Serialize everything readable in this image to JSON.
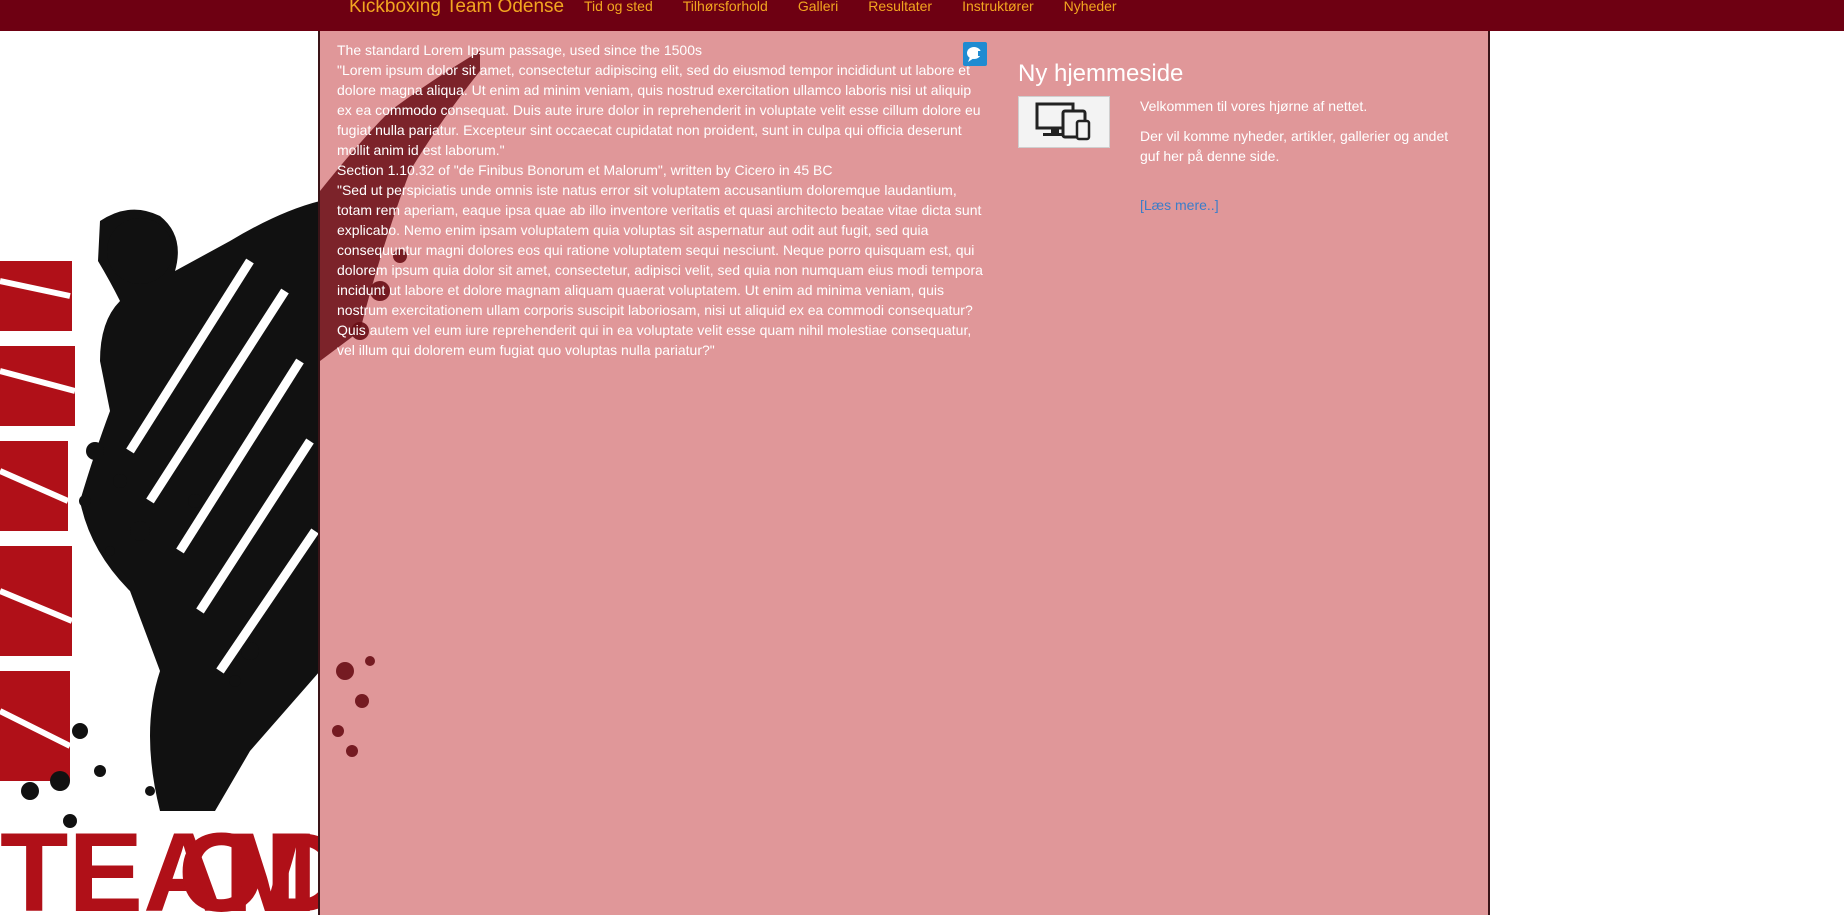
{
  "navbar": {
    "brand": "Kickboxing Team Odense",
    "links": [
      "Tid og sted",
      "Tilhørsforhold",
      "Galleri",
      "Resultater",
      "Instruktører",
      "Nyheder"
    ]
  },
  "background": {
    "logo_word": "ODENSE",
    "logo_partial": "TEAM"
  },
  "main": {
    "paragraphs": [
      "The standard Lorem Ipsum passage, used since the 1500s",
      "\"Lorem ipsum dolor sit amet, consectetur adipiscing elit, sed do eiusmod tempor incididunt ut labore et dolore magna aliqua. Ut enim ad minim veniam, quis nostrud exercitation ullamco laboris nisi ut aliquip ex ea commodo consequat. Duis aute irure dolor in reprehenderit in voluptate velit esse cillum dolore eu fugiat nulla pariatur. Excepteur sint occaecat cupidatat non proident, sunt in culpa qui officia deserunt mollit anim id est laborum.\"",
      "Section 1.10.32 of \"de Finibus Bonorum et Malorum\", written by Cicero in 45 BC",
      "\"Sed ut perspiciatis unde omnis iste natus error sit voluptatem accusantium doloremque laudantium, totam rem aperiam, eaque ipsa quae ab illo inventore veritatis et quasi architecto beatae vitae dicta sunt explicabo. Nemo enim ipsam voluptatem quia voluptas sit aspernatur aut odit aut fugit, sed quia consequuntur magni dolores eos qui ratione voluptatem sequi nesciunt. Neque porro quisquam est, qui dolorem ipsum quia dolor sit amet, consectetur, adipisci velit, sed quia non numquam eius modi tempora incidunt ut labore et dolore magnam aliquam quaerat voluptatem. Ut enim ad minima veniam, quis nostrum exercitationem ullam corporis suscipit laboriosam, nisi ut aliquid ex ea commodi consequatur? Quis autem vel eum iure reprehenderit qui in ea voluptate velit esse quam nihil molestiae consequatur, vel illum qui dolorem eum fugiat quo voluptas nulla pariatur?\""
    ],
    "chat_icon": "chat-bubble-icon"
  },
  "sidebar": {
    "title": "Ny hjemmeside",
    "thumbnail_icon": "devices-icon",
    "text": [
      "Velkommen til vores hjørne af nettet.",
      "Der vil komme nyheder, artikler, gallerier og andet guf her på denne side."
    ],
    "read_more": "[Læs mere..]"
  },
  "colors": {
    "navbar_bg": "#6e0012",
    "nav_link": "#f2a520",
    "panel_bg": "#e09799",
    "link": "#3b7dc9",
    "logo_red": "#b01018"
  }
}
